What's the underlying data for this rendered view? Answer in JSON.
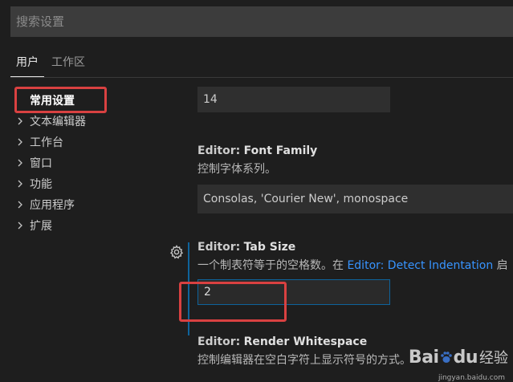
{
  "search": {
    "placeholder": "搜索设置"
  },
  "tabs": [
    {
      "label": "用户",
      "active": true
    },
    {
      "label": "工作区",
      "active": false
    }
  ],
  "sidebar": {
    "items": [
      {
        "label": "常用设置",
        "selected": true,
        "expandable": false
      },
      {
        "label": "文本编辑器",
        "selected": false,
        "expandable": true
      },
      {
        "label": "工作台",
        "selected": false,
        "expandable": true
      },
      {
        "label": "窗口",
        "selected": false,
        "expandable": true
      },
      {
        "label": "功能",
        "selected": false,
        "expandable": true
      },
      {
        "label": "应用程序",
        "selected": false,
        "expandable": true
      },
      {
        "label": "扩展",
        "selected": false,
        "expandable": true
      }
    ]
  },
  "settings": {
    "font_size": {
      "value": "14"
    },
    "font_family": {
      "category": "Editor:",
      "name": "Font Family",
      "description": "控制字体系列。",
      "value": "Consolas, 'Courier New', monospace"
    },
    "tab_size": {
      "category": "Editor:",
      "name": "Tab Size",
      "description_prefix": "一个制表符等于的空格数。在 ",
      "link": "Editor: Detect Indentation",
      "description_suffix": " 启",
      "value": "2"
    },
    "render_whitespace": {
      "category": "Editor:",
      "name": "Render Whitespace",
      "description": "控制编辑器在空白字符上显示符号的方式。"
    }
  },
  "watermark": {
    "logo": "Bai",
    "logo_suffix": "du",
    "text": "经验",
    "url": "jingyan.baidu.com"
  },
  "colors": {
    "background": "#1e1e1e",
    "input_bg": "#2f2f2f",
    "focus_border": "#0e639c",
    "link": "#3794ff",
    "annotation_red": "#d94141"
  }
}
